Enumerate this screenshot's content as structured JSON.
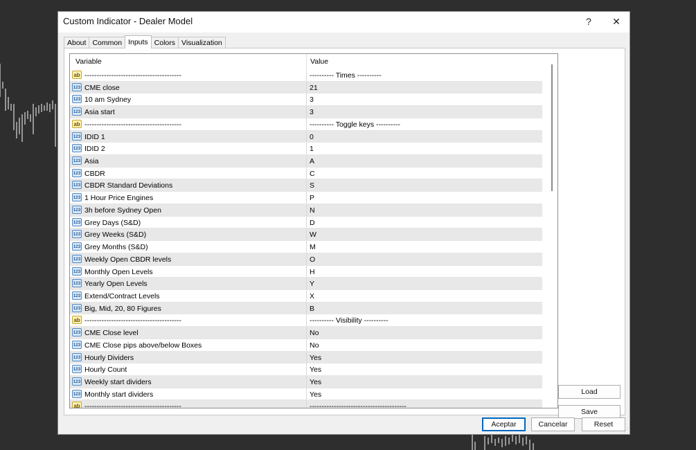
{
  "window": {
    "title": "Custom Indicator - Dealer Model",
    "help_label": "?",
    "close_label": "✕"
  },
  "tabs": [
    {
      "label": "About"
    },
    {
      "label": "Common"
    },
    {
      "label": "Inputs",
      "active": true
    },
    {
      "label": "Colors"
    },
    {
      "label": "Visualization"
    }
  ],
  "grid": {
    "headers": {
      "variable": "Variable",
      "value": "Value"
    },
    "rows": [
      {
        "type": "ab",
        "icon": "ab",
        "variable": "----------------------------------------",
        "value": "----------   Times   ----------"
      },
      {
        "type": "123",
        "icon": "123",
        "variable": "CME close",
        "value": "21"
      },
      {
        "type": "123",
        "icon": "123",
        "variable": "10 am Sydney",
        "value": "3"
      },
      {
        "type": "123",
        "icon": "123",
        "variable": "Asia start",
        "value": "3"
      },
      {
        "type": "ab",
        "icon": "ab",
        "variable": "----------------------------------------",
        "value": "---------- Toggle keys ----------"
      },
      {
        "type": "123",
        "icon": "123",
        "variable": "IDID 1",
        "value": "0"
      },
      {
        "type": "123",
        "icon": "123",
        "variable": "IDID 2",
        "value": "1"
      },
      {
        "type": "123",
        "icon": "123",
        "variable": "Asia",
        "value": "A"
      },
      {
        "type": "123",
        "icon": "123",
        "variable": "CBDR",
        "value": "C"
      },
      {
        "type": "123",
        "icon": "123",
        "variable": "CBDR Standard Deviations",
        "value": "S"
      },
      {
        "type": "123",
        "icon": "123",
        "variable": "1 Hour Price Engines",
        "value": "P"
      },
      {
        "type": "123",
        "icon": "123",
        "variable": "3h before Sydney Open",
        "value": "N"
      },
      {
        "type": "123",
        "icon": "123",
        "variable": "Grey Days (S&D)",
        "value": "D"
      },
      {
        "type": "123",
        "icon": "123",
        "variable": "Grey Weeks (S&D)",
        "value": "W"
      },
      {
        "type": "123",
        "icon": "123",
        "variable": "Grey Months (S&D)",
        "value": "M"
      },
      {
        "type": "123",
        "icon": "123",
        "variable": "Weekly Open CBDR levels",
        "value": "O"
      },
      {
        "type": "123",
        "icon": "123",
        "variable": "Monthly Open Levels",
        "value": "H"
      },
      {
        "type": "123",
        "icon": "123",
        "variable": "Yearly Open Levels",
        "value": "Y"
      },
      {
        "type": "123",
        "icon": "123",
        "variable": "Extend/Contract Levels",
        "value": "X"
      },
      {
        "type": "123",
        "icon": "123",
        "variable": "Big, Mid, 20, 80 Figures",
        "value": "B"
      },
      {
        "type": "ab",
        "icon": "ab",
        "variable": "----------------------------------------",
        "value": "----------  Visibility ----------"
      },
      {
        "type": "123",
        "icon": "123",
        "variable": "CME Close level",
        "value": "No"
      },
      {
        "type": "123",
        "icon": "123",
        "variable": "CME Close pips above/below Boxes",
        "value": "No"
      },
      {
        "type": "123",
        "icon": "123",
        "variable": "Hourly Dividers",
        "value": "Yes"
      },
      {
        "type": "123",
        "icon": "123",
        "variable": "Hourly Count",
        "value": "Yes"
      },
      {
        "type": "123",
        "icon": "123",
        "variable": "Weekly start dividers",
        "value": "Yes"
      },
      {
        "type": "123",
        "icon": "123",
        "variable": "Monthly start dividers",
        "value": "Yes"
      },
      {
        "type": "ab",
        "icon": "ab",
        "variable": "----------------------------------------",
        "value": "----------------------------------------"
      }
    ]
  },
  "side_buttons": {
    "load": "Load",
    "save": "Save"
  },
  "footer_buttons": {
    "ok": "Aceptar",
    "cancel": "Cancelar",
    "reset": "Reset"
  },
  "colors": {
    "accent": "#0067c0",
    "alt_row": "#e8e8e8",
    "background": "#2e2e2e"
  }
}
